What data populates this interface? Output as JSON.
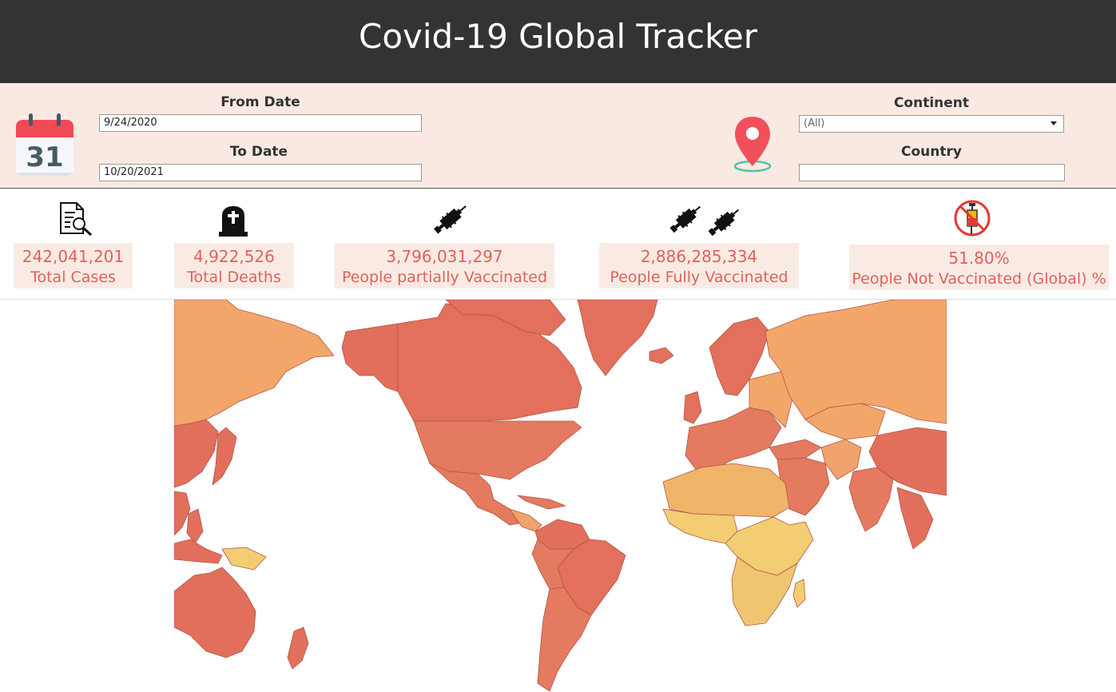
{
  "header": {
    "title": "Covid-19 Global Tracker"
  },
  "filters": {
    "from_label": "From Date",
    "from_value": "9/24/2020",
    "to_label": "To Date",
    "to_value": "10/20/2021",
    "calendar_day": "31",
    "continent_label": "Continent",
    "continent_value": "(All)",
    "country_label": "Country",
    "country_value": ""
  },
  "kpis": [
    {
      "value": "242,041,201",
      "label": "Total Cases",
      "icon": "document-search-icon"
    },
    {
      "value": "4,922,526",
      "label": "Total Deaths",
      "icon": "tombstone-icon"
    },
    {
      "value": "3,796,031,297",
      "label": "People partially Vaccinated",
      "icon": "syringe-icon"
    },
    {
      "value": "2,886,285,334",
      "label": "People Fully Vaccinated",
      "icon": "two-syringes-icon"
    },
    {
      "value": "51.80%",
      "label": "People Not Vaccinated (Global) %",
      "icon": "no-vaccine-icon"
    }
  ],
  "colors": {
    "header_bg": "#333333",
    "filter_bg": "#fae9e2",
    "kpi_text": "#e0625a",
    "kpi_box": "#faeae4",
    "map_high": "#e2705c",
    "map_mid": "#f3a76a",
    "map_low": "#f2cd72"
  }
}
